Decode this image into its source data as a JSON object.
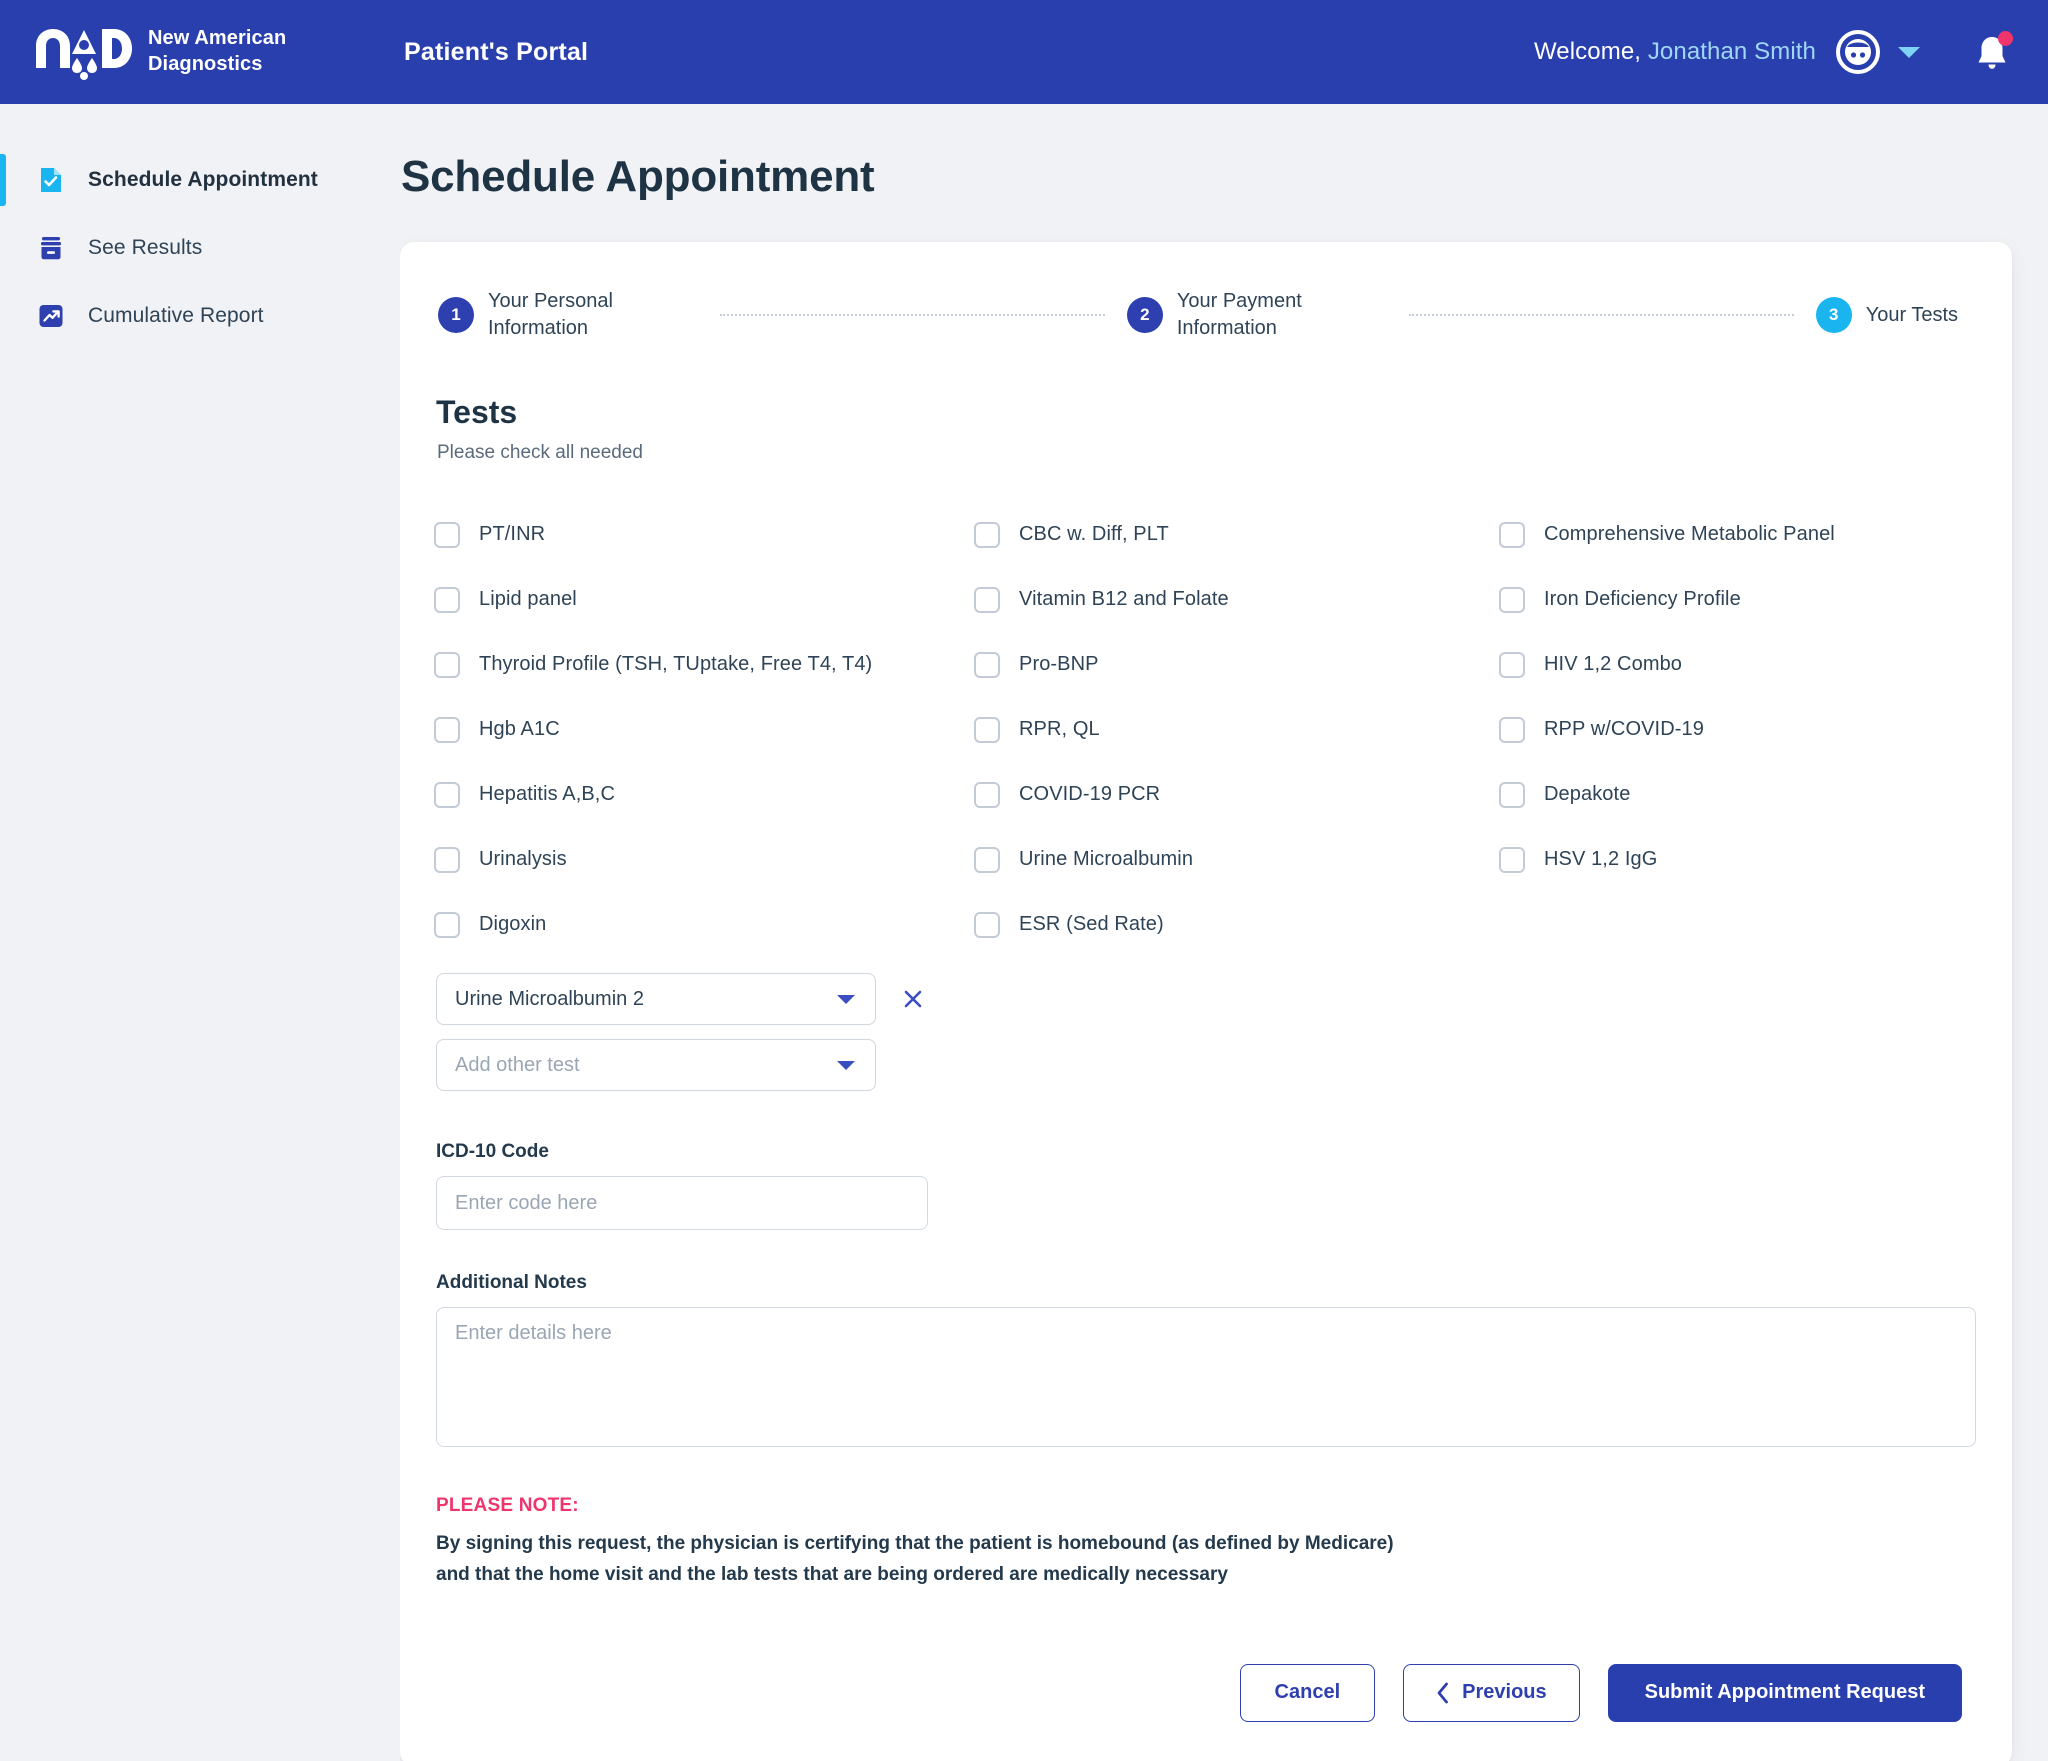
{
  "header": {
    "logo_alt": "NAD",
    "brand_line1": "New American",
    "brand_line2": "Diagnostics",
    "portal_title": "Patient's Portal",
    "welcome_prefix": "Welcome,",
    "user_name": "Jonathan Smith",
    "accent_blue": "#2a3fae",
    "user_name_color": "#9fd8f7",
    "notification_dot_color": "#f0356c"
  },
  "sidebar": {
    "items": [
      {
        "label": "Schedule Appointment",
        "icon": "document-check-icon",
        "active": true
      },
      {
        "label": "See Results",
        "icon": "archive-box-icon",
        "active": false
      },
      {
        "label": "Cumulative Report",
        "icon": "trending-up-icon",
        "active": false
      }
    ]
  },
  "page": {
    "title": "Schedule Appointment"
  },
  "stepper": {
    "steps": [
      {
        "number": "1",
        "label": "Your Personal Information",
        "state": "done",
        "color": "#2e3fb0"
      },
      {
        "number": "2",
        "label": "Your Payment Information",
        "state": "done",
        "color": "#2e3fb0"
      },
      {
        "number": "3",
        "label": "Your Tests",
        "state": "active",
        "color": "#1ab4ef"
      }
    ]
  },
  "tests_section": {
    "title": "Tests",
    "subtitle": "Please check all needed",
    "column1": [
      {
        "label": "PT/INR",
        "checked": false
      },
      {
        "label": "Lipid panel",
        "checked": false
      },
      {
        "label": "Thyroid Profile (TSH, TUptake, Free T4, T4)",
        "checked": false
      },
      {
        "label": "Hgb A1C",
        "checked": false
      },
      {
        "label": "Hepatitis A,B,C",
        "checked": false
      },
      {
        "label": "Urinalysis",
        "checked": false
      },
      {
        "label": "Digoxin",
        "checked": false
      }
    ],
    "column2": [
      {
        "label": "CBC w. Diff, PLT",
        "checked": false
      },
      {
        "label": "Vitamin B12 and Folate",
        "checked": false
      },
      {
        "label": "Pro-BNP",
        "checked": false
      },
      {
        "label": "RPR, QL",
        "checked": false
      },
      {
        "label": "COVID-19 PCR",
        "checked": false
      },
      {
        "label": "Urine Microalbumin",
        "checked": false
      },
      {
        "label": "ESR (Sed Rate)",
        "checked": false
      }
    ],
    "column3": [
      {
        "label": "Comprehensive Metabolic Panel",
        "checked": false
      },
      {
        "label": "Iron Deficiency Profile",
        "checked": false
      },
      {
        "label": "HIV 1,2 Combo",
        "checked": false
      },
      {
        "label": "RPP w/COVID-19",
        "checked": false
      },
      {
        "label": "Depakote",
        "checked": false
      },
      {
        "label": "HSV 1,2 IgG",
        "checked": false
      }
    ]
  },
  "other_tests": {
    "selected_value": "Urine Microalbumin 2",
    "add_placeholder": "Add other test",
    "remove_icon": "close-x-icon"
  },
  "icd": {
    "label": "ICD-10 Code",
    "placeholder": "Enter code here",
    "value": ""
  },
  "notes": {
    "label": "Additional Notes",
    "placeholder": "Enter details here",
    "value": ""
  },
  "please_note": {
    "heading": "PLEASE NOTE:",
    "line1": "By signing this request, the physician is certifying that the patient is homebound (as defined by Medicare)",
    "line2": "and that the home visit and the lab tests that are being ordered are medically necessary",
    "heading_color": "#f0356c"
  },
  "actions": {
    "cancel": "Cancel",
    "previous": "Previous",
    "submit": "Submit Appointment Request"
  }
}
